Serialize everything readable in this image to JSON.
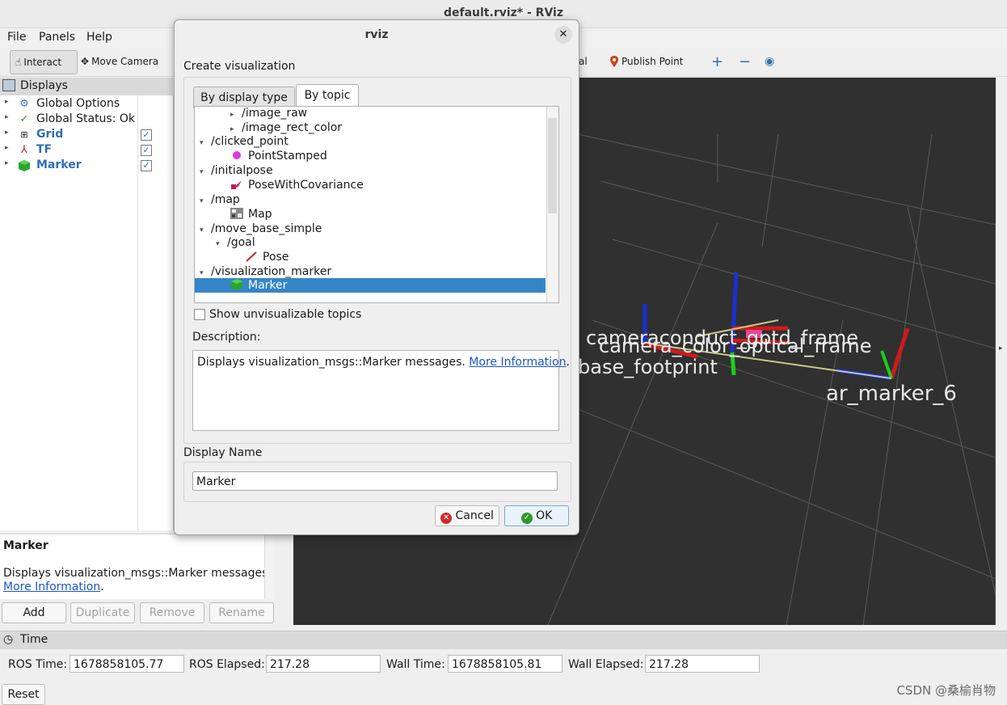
{
  "window": {
    "title": "default.rviz* - RViz"
  },
  "menu": [
    "File",
    "Panels",
    "Help"
  ],
  "toolbar": {
    "interact": "Interact",
    "move_camera": "Move Camera",
    "goal_partial": "al",
    "publish_point": "Publish Point"
  },
  "displays": {
    "header": "Displays",
    "items": [
      {
        "label": "Global Options",
        "icon": "gear-icon"
      },
      {
        "label": "Global Status: Ok",
        "icon": "checkmark-icon"
      },
      {
        "label": "Grid",
        "icon": "grid-icon",
        "checked": "✓"
      },
      {
        "label": "TF",
        "icon": "tf-axes-icon",
        "checked": "✓"
      },
      {
        "label": "Marker",
        "icon": "cube-icon",
        "checked": "✓"
      }
    ],
    "description_title": "Marker",
    "description_text": "Displays visualization_msgs::Marker messages.",
    "more_info": "More Information",
    "buttons": {
      "add": "Add",
      "duplicate": "Duplicate",
      "remove": "Remove",
      "rename": "Rename"
    }
  },
  "scene_labels": {
    "overlap_top": "cameraconduct_gptd_frame",
    "overlap_bottom": "camera_color_optical_frame",
    "base": "base_footprint",
    "marker": "ar_marker_6"
  },
  "time": {
    "header": "Time",
    "ros_time_label": "ROS Time:",
    "ros_time": "1678858105.77",
    "ros_elapsed_label": "ROS Elapsed:",
    "ros_elapsed": "217.28",
    "wall_time_label": "Wall Time:",
    "wall_time": "1678858105.81",
    "wall_elapsed_label": "Wall Elapsed:",
    "wall_elapsed": "217.28",
    "reset": "Reset"
  },
  "dialog": {
    "title": "rviz",
    "heading": "Create visualization",
    "tabs": [
      "By display type",
      "By topic"
    ],
    "active_tab": "By topic",
    "tree": [
      {
        "label": "/image_raw",
        "expander": "▸"
      },
      {
        "label": "/image_rect_color",
        "expander": "▸"
      },
      {
        "label": "/clicked_point",
        "expander": "▾"
      },
      {
        "label": "PointStamped",
        "icon": "point-icon"
      },
      {
        "label": "/initialpose",
        "expander": "▾"
      },
      {
        "label": "PoseWithCovariance",
        "icon": "pose-covariance-icon"
      },
      {
        "label": "/map",
        "expander": "▾"
      },
      {
        "label": "Map",
        "icon": "map-icon"
      },
      {
        "label": "/move_base_simple",
        "expander": "▾"
      },
      {
        "label": "/goal",
        "expander": "▾"
      },
      {
        "label": "Pose",
        "icon": "pose-arrow-icon"
      },
      {
        "label": "/visualization_marker",
        "expander": "▾"
      },
      {
        "label": "Marker",
        "icon": "cube-icon",
        "selected": true
      }
    ],
    "show_unvisualizable": "Show unvisualizable topics",
    "description_label": "Description:",
    "description_text": "Displays visualization_msgs::Marker messages.",
    "more_info": "More Information",
    "display_name_label": "Display Name",
    "display_name_value": "Marker",
    "cancel": "Cancel",
    "ok": "OK"
  },
  "watermark": "CSDN @桑榆肖物",
  "colors": {
    "selection": "#3585c6",
    "view_bg": "#303030",
    "link": "#1a56c8",
    "tree_blue": "#2f6fb3"
  }
}
